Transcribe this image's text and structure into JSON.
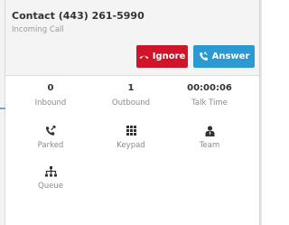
{
  "call": {
    "title": "Contact (443) 261-5990",
    "status": "Incoming Call"
  },
  "actions": {
    "ignore_label": "Ignore",
    "answer_label": "Answer"
  },
  "stats": [
    {
      "value": "0",
      "label": "Inbound"
    },
    {
      "value": "1",
      "label": "Outbound"
    },
    {
      "value": "00:00:06",
      "label": "Talk Time"
    }
  ],
  "tools": [
    {
      "label": "Parked",
      "icon": "parked-phone-icon"
    },
    {
      "label": "Keypad",
      "icon": "keypad-icon"
    },
    {
      "label": "Team",
      "icon": "team-icon"
    },
    {
      "label": "Queue",
      "icon": "queue-icon"
    }
  ],
  "colors": {
    "ignore": "#d0142a",
    "answer": "#2b9ad2",
    "header_bg": "#f4f4f4"
  }
}
